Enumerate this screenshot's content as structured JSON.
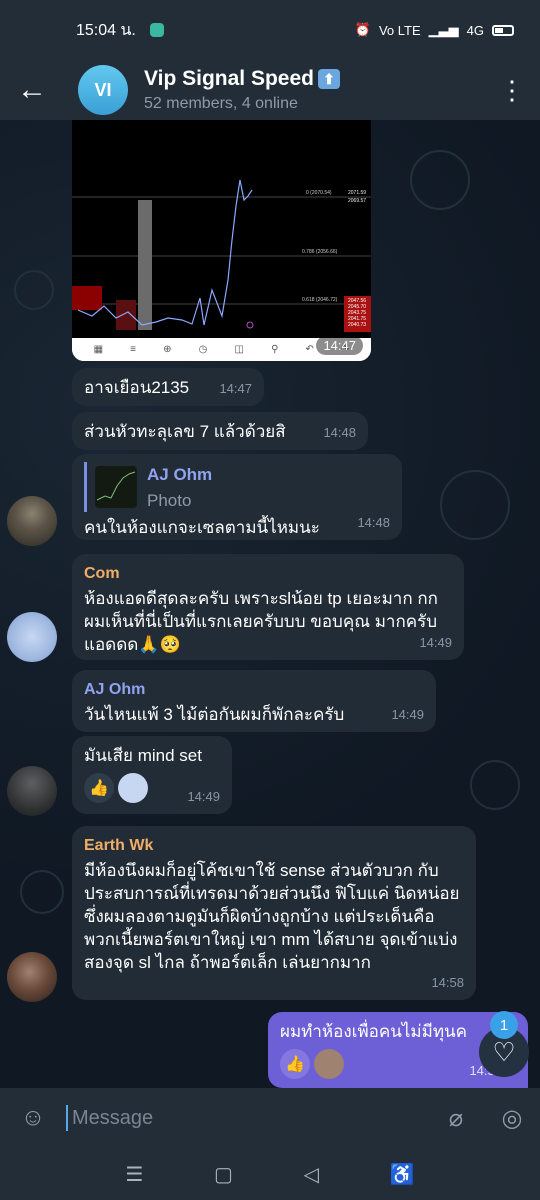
{
  "status": {
    "time": "15:04 น.",
    "signal": "Vo LTE",
    "network": "4G"
  },
  "header": {
    "back_icon": "arrow-left-icon",
    "avatar_initials": "VI",
    "title": "Vip Signal Speed",
    "subtitle": "52 members, 4 online",
    "menu_icon": "more-vertical-icon"
  },
  "messages": {
    "photo_time": "14:47",
    "m1": {
      "text": "อาจเยือน2135",
      "time": "14:47"
    },
    "m2": {
      "text": "ส่วนหัวทะลุเลข 7 แล้วด้วยสิ",
      "time": "14:48"
    },
    "m3": {
      "reply_name": "AJ Ohm",
      "reply_sub": "Photo",
      "text": "คนในห้องแกจะเซลตามนี้ไหมนะ",
      "time": "14:48"
    },
    "m4": {
      "name": "Com",
      "name_color": "#f0ad67",
      "text": "ห้องแอดดีสุดละครับ เพราะslน้อย tp เยอะมาก กก ผมเห็นที่นี่เป็นที่แรกเลยครับบบ ขอบคุณ มากครับแอดดด🙏🥺",
      "time": "14:49"
    },
    "m5": {
      "name": "AJ Ohm",
      "name_color": "#8fa3f0",
      "text": "วันไหนแพ้ 3 ไม้ต่อกันผมก็พักละครับ",
      "time": "14:49"
    },
    "m6": {
      "text": "มันเสีย mind set",
      "reaction": "👍",
      "time": "14:49"
    },
    "m7": {
      "name": "Earth Wk",
      "name_color": "#f0ad67",
      "text": "มีห้องนึงผมก็อยู่โค้ชเขาใช้ sense ส่วนตัวบวก กับประสบการณ์ที่เทรดมาด้วยส่วนนึง ฟิโบแค่ นิดหน่อย ซึ่งผมลองตามดูมันก็ผิดบ้างถูกบ้าง แต่ประเด็นคือพวกเนี้ยพอร์ตเขาใหญ่ เขา mm ได้สบาย จุดเข้าแบ่งสองจุด sl ไกล ถ้าพอร์ตเล็ก เล่นยากมาก",
      "time": "14:58"
    },
    "m8": {
      "text": "ผมทำห้องเพื่อคนไม่มีทุนค",
      "reaction": "👍",
      "time": "14:59"
    }
  },
  "chart": {
    "levels": [
      "2071.59",
      "2069.57",
      "2047.56",
      "2045.70",
      "2043.75",
      "2041.75",
      "2040.73"
    ],
    "fib_labels": [
      "0 (2070.54)",
      "0.786 (2056.66)",
      "0.618 (2046.72)"
    ]
  },
  "fab": {
    "badge": "1",
    "icon": "heart-icon"
  },
  "input": {
    "placeholder": "Message",
    "sticker_icon": "sticker-icon",
    "attach_icon": "paperclip-icon",
    "camera_icon": "instagram-camera-icon"
  }
}
